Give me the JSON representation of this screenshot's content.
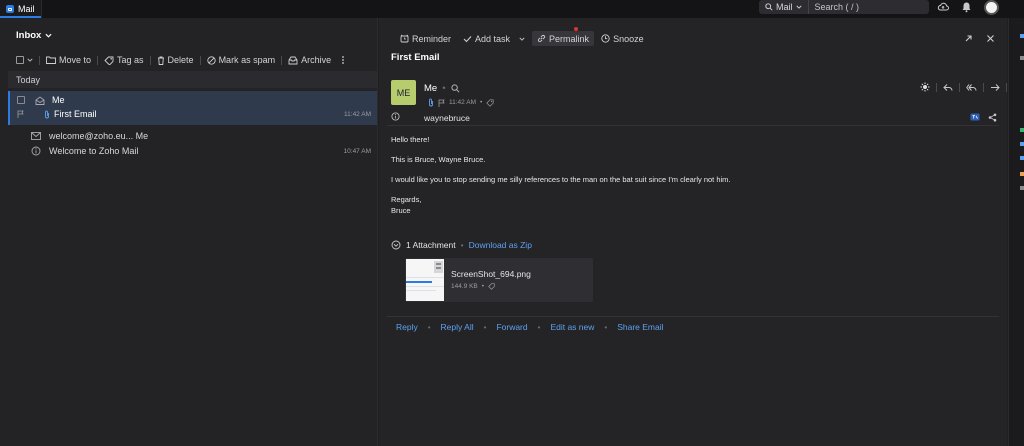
{
  "app": {
    "tab_label": "Mail"
  },
  "topbar": {
    "search_scope": "Mail",
    "search_placeholder": "Search ( / )"
  },
  "folder": {
    "name": "Inbox"
  },
  "list_toolbar": {
    "move_to": "Move to",
    "tag_as": "Tag as",
    "delete": "Delete",
    "mark_as_spam": "Mark as spam",
    "archive": "Archive"
  },
  "list": {
    "group_header": "Today",
    "items": [
      {
        "sender": "Me",
        "subject": "First Email",
        "time": "11:42 AM"
      },
      {
        "sender": "welcome@zoho.eu... Me",
        "subject": "Welcome to Zoho Mail",
        "time": "10:47 AM"
      }
    ]
  },
  "read_toolbar": {
    "reminder": "Reminder",
    "add_task": "Add task",
    "permalink": "Permalink",
    "snooze": "Snooze"
  },
  "message": {
    "subject": "First Email",
    "avatar_initials": "ME",
    "sender": "Me",
    "time": "11:42 AM",
    "to": "waynebruce",
    "body": {
      "greeting": "Hello there!",
      "line1": "This is Bruce, Wayne Bruce.",
      "line2": "I would like you to stop sending me silly references to the man on the bat suit since I'm clearly not him.",
      "regards": "Regards,",
      "signature": "Bruce"
    }
  },
  "attachments": {
    "count_label": "1 Attachment",
    "download_label": "Download as Zip",
    "file": {
      "name": "ScreenShot_694.png",
      "size": "144.9 KB"
    }
  },
  "reply_bar": {
    "reply": "Reply",
    "reply_all": "Reply All",
    "forward": "Forward",
    "edit_as_new": "Edit as new",
    "share_email": "Share Email"
  },
  "colors": {
    "accent": "#2c7be5",
    "link": "#5ea0f0",
    "avatar_bg": "#b6cc6d"
  }
}
